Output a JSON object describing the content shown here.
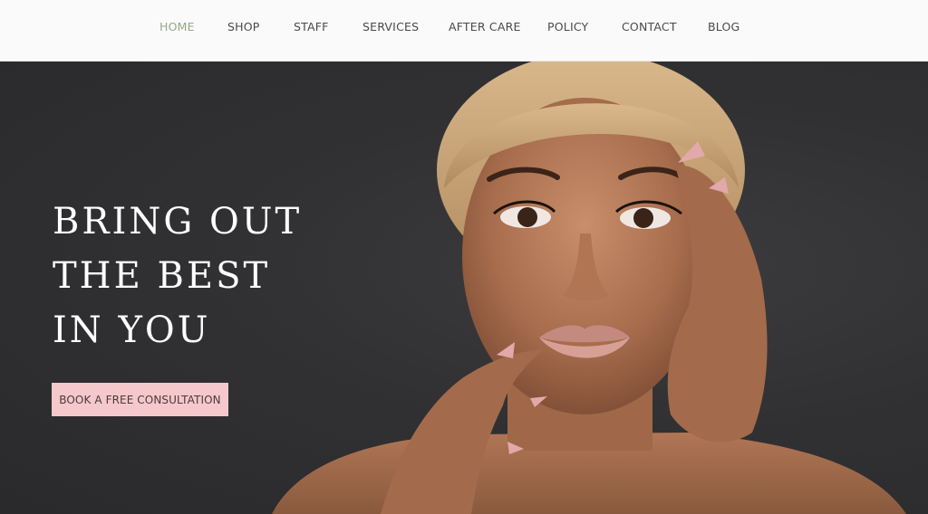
{
  "nav": {
    "items": [
      {
        "label": "HOME",
        "active": true
      },
      {
        "label": "SHOP",
        "active": false
      },
      {
        "label": "STAFF",
        "active": false
      },
      {
        "label": "SERVICES",
        "active": false
      },
      {
        "label": "AFTER CARE",
        "active": false
      },
      {
        "label": "POLICY",
        "active": false
      },
      {
        "label": "CONTACT",
        "active": false
      },
      {
        "label": "BLOG",
        "active": false
      }
    ],
    "active_color": "#97a888"
  },
  "hero": {
    "headline_lines": [
      "BRING OUT",
      "THE BEST",
      "IN YOU"
    ],
    "cta_label": "BOOK A FREE CONSULTATION",
    "cta_color": "#f5c8cb",
    "image": "woman-portrait-with-pink-nails"
  }
}
